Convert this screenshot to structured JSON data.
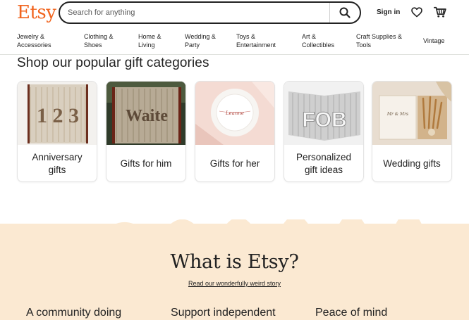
{
  "header": {
    "logo": "Etsy",
    "search_placeholder": "Search for anything",
    "sign_in": "Sign in",
    "icons": {
      "search": "search-icon",
      "favorites": "heart-icon",
      "cart": "cart-icon"
    }
  },
  "nav": [
    {
      "line1": "Jewelry &",
      "line2": "Accessories"
    },
    {
      "line1": "Clothing &",
      "line2": "Shoes"
    },
    {
      "line1": "Home &",
      "line2": "Living"
    },
    {
      "line1": "Wedding &",
      "line2": "Party"
    },
    {
      "line1": "Toys &",
      "line2": "Entertainment"
    },
    {
      "line1": "Art &",
      "line2": "Collectibles"
    },
    {
      "line1": "Craft Supplies &",
      "line2": "Tools"
    },
    {
      "line1": "Vintage",
      "line2": ""
    }
  ],
  "gifts": {
    "title": "Shop our popular gift categories",
    "cards": [
      {
        "line1": "Anniversary",
        "line2": "gifts",
        "image_text": "1 2 3"
      },
      {
        "line1": "Gifts for him",
        "line2": "",
        "image_text": "Waite"
      },
      {
        "line1": "Gifts for her",
        "line2": "",
        "image_text": "Leanne"
      },
      {
        "line1": "Personalized",
        "line2": "gift ideas",
        "image_text": "FOB"
      },
      {
        "line1": "Wedding gifts",
        "line2": "",
        "image_text": "Mr & Mrs"
      }
    ]
  },
  "what_is_etsy": {
    "title": "What is Etsy?",
    "link": "Read our wonderfully weird story",
    "columns": [
      "A community doing",
      "Support independent",
      "Peace of mind"
    ]
  },
  "colors": {
    "brand": "#f1641e",
    "band": "#fbe9d2",
    "text": "#222222"
  }
}
